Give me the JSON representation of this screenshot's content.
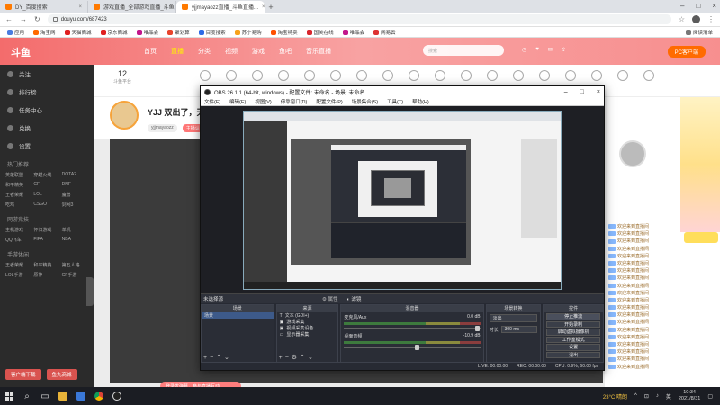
{
  "browser": {
    "tabs": [
      {
        "label": "DY_百度搜索",
        "active": false
      },
      {
        "label": "游戏直播_全部游戏直播_斗鱼直...",
        "active": false
      },
      {
        "label": "yjjmayaozz直播_斗鱼直播...",
        "active": true
      }
    ],
    "url": "douyu.com/687423",
    "bookmarks": [
      "应用",
      "淘宝网",
      "天猫商城",
      "京东商城",
      "唯品会",
      "聚划算",
      "百度搜索",
      "苏宁易购",
      "淘宝特卖",
      "国美在线",
      "唯品会",
      "网易云",
      "阅读清单"
    ]
  },
  "site": {
    "logo": "斗鱼",
    "nav": [
      "首页",
      "直播",
      "分类",
      "视频",
      "游戏",
      "鱼吧",
      "音乐直播"
    ],
    "active_nav": "直播",
    "search_placeholder": "搜索",
    "download_btn": "PC客户端"
  },
  "left_sidebar": {
    "items": [
      "关注",
      "排行榜",
      "任务中心",
      "兑换",
      "设置"
    ],
    "sections": [
      {
        "title": "热门推荐",
        "tags": [
          "英雄联盟",
          "穿越火线",
          "DOTA2",
          "和平精英",
          "CF",
          "DNF",
          "王者荣耀",
          "LOL",
          "魔兽",
          "吃鸡",
          "CSGO",
          "剑网3"
        ]
      },
      {
        "title": "网游竞技",
        "tags": [
          "主机游戏",
          "怀旧游戏",
          "单机",
          "QQ飞车",
          "FIFA",
          "NBA"
        ]
      },
      {
        "title": "手游休闲",
        "tags": [
          "王者荣耀",
          "和平精英",
          "第五人格",
          "LOL手游",
          "原神",
          "CF手游"
        ]
      }
    ],
    "red_buttons": [
      "客户端下载",
      "鱼丸商城"
    ]
  },
  "room": {
    "stat_number": "12",
    "stat_label": "斗鱼平台",
    "anchor_name": "YJJ 双出了，天人",
    "tags": [
      "yjjmayaozz",
      "主播认证"
    ]
  },
  "chat": {
    "lines": [
      "欢迎来到直播间",
      "欢迎来到直播间",
      "欢迎来到直播间",
      "欢迎来到直播间",
      "欢迎来到直播间",
      "欢迎来到直播间",
      "欢迎来到直播间",
      "欢迎来到直播间",
      "欢迎来到直播间",
      "欢迎来到直播间",
      "欢迎来到直播间",
      "欢迎来到直播间",
      "欢迎来到直播间",
      "欢迎来到直播间",
      "欢迎来到直播间",
      "欢迎来到直播间",
      "欢迎来到直播间",
      "欢迎来到直播间",
      "欢迎来到直播间",
      "欢迎来到直播间"
    ],
    "send_hint": "登录发弹幕，参与直播互动"
  },
  "obs": {
    "title": "OBS 26.1.1 (64-bit, windows) - 配置文件: 未命名 - 场景: 未命名",
    "menu": [
      "文件(F)",
      "编辑(E)",
      "视图(V)",
      "停靠窗口(D)",
      "配置文件(P)",
      "场景集合(S)",
      "工具(T)",
      "帮助(H)"
    ],
    "no_source": "未选择源",
    "props_btn": "属性",
    "filters_btn": "滤镜",
    "docks": {
      "scenes": {
        "title": "场景",
        "items": [
          "场景"
        ]
      },
      "sources": {
        "title": "来源",
        "items": [
          "文本 (GDI+)",
          "游戏采集",
          "视频采集设备",
          "显示器采集"
        ]
      },
      "mixer": {
        "title": "混音器",
        "channels": [
          {
            "name": "麦克风/Aux",
            "db": "0.0 dB"
          },
          {
            "name": "桌面音频",
            "db": "-10.9 dB"
          }
        ]
      },
      "transitions": {
        "title": "场景转换",
        "type": "淡出",
        "duration_label": "时长",
        "duration": "300 ms"
      },
      "controls": {
        "title": "控件",
        "buttons": [
          "停止推流",
          "开始录制",
          "启动虚拟摄像机",
          "工作室模式",
          "设置",
          "退出"
        ]
      }
    },
    "status": [
      "LIVE: 00:00:00",
      "REC: 00:00:00",
      "CPU: 0.9%, 60.00 fps"
    ]
  },
  "taskbar": {
    "weather": "23°C 晴朗",
    "lang": "英",
    "time": "10:34",
    "date": "2021/8/31"
  }
}
